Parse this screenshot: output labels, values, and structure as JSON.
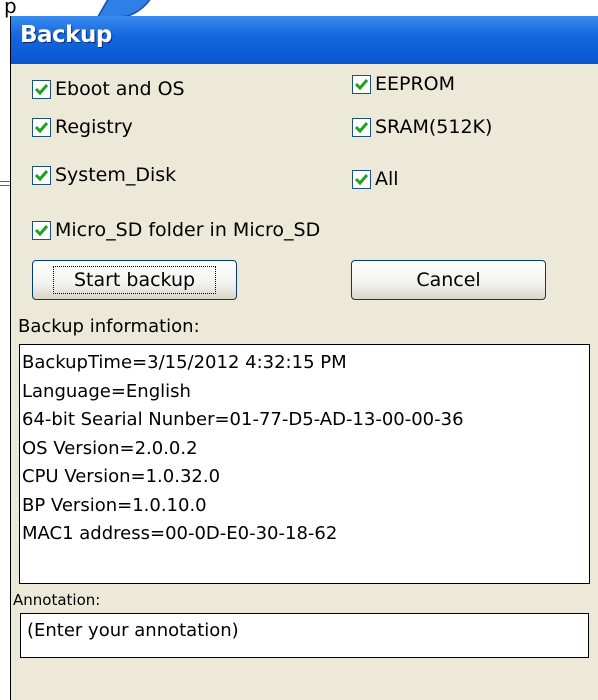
{
  "window": {
    "title": "Backup"
  },
  "checkboxes": {
    "eboot_os": {
      "label": "Eboot and OS",
      "checked": true
    },
    "eeprom": {
      "label": "EEPROM",
      "checked": true
    },
    "registry": {
      "label": "Registry",
      "checked": true
    },
    "sram": {
      "label": "SRAM(512K)",
      "checked": true
    },
    "system_disk": {
      "label": "System_Disk",
      "checked": true
    },
    "all": {
      "label": "All",
      "checked": true
    },
    "micro_sd": {
      "label": "Micro_SD folder in Micro_SD",
      "checked": true
    }
  },
  "buttons": {
    "start_backup": "Start backup",
    "cancel": "Cancel"
  },
  "backup_info": {
    "label": "Backup information:",
    "lines": [
      "BackupTime=3/15/2012 4:32:15 PM",
      "Language=English",
      "64-bit Searial Nunber=01-77-D5-AD-13-00-00-36",
      "OS Version=2.0.0.2",
      "CPU Version=1.0.32.0",
      "BP Version=1.0.10.0",
      "MAC1 address=00-0D-E0-30-18-62"
    ]
  },
  "annotation": {
    "label": "Annotation:",
    "placeholder": "(Enter your annotation)"
  },
  "colors": {
    "titlebar": "#0a55d0",
    "check": "#21a121",
    "window_bg": "#ece9d8"
  }
}
